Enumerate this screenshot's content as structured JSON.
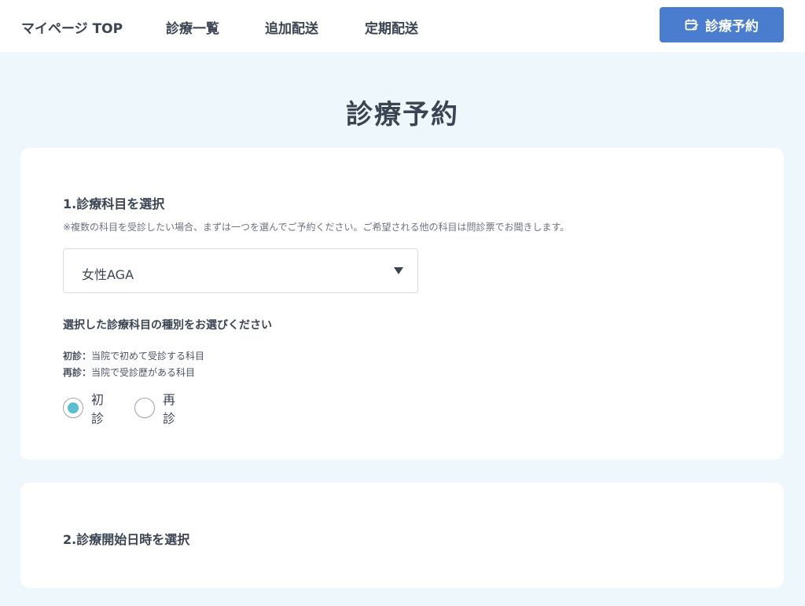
{
  "nav": {
    "items": [
      {
        "label": "マイページ TOP"
      },
      {
        "label": "診療一覧"
      },
      {
        "label": "追加配送"
      },
      {
        "label": "定期配送"
      }
    ],
    "reserve_button": {
      "label": "診療予約",
      "icon": "calendar-edit-icon"
    }
  },
  "page": {
    "title": "診療予約"
  },
  "section1": {
    "heading": "1.診療科目を選択",
    "note": "※複数の科目を受診したい場合、まずは一つを選んでご予約ください。ご希望される他の科目は問診票でお聞きします。",
    "select": {
      "value": "女性AGA"
    },
    "type_heading": "選択した診療科目の種別をお選びください",
    "definitions": [
      {
        "term": "初診：",
        "desc": "当院で初めて受診する科目"
      },
      {
        "term": "再診：",
        "desc": "当院で受診歴がある科目"
      }
    ],
    "radios": [
      {
        "label": "初診",
        "checked": true
      },
      {
        "label": "再診",
        "checked": false
      }
    ]
  },
  "section2": {
    "heading": "2.診療開始日時を選択"
  },
  "colors": {
    "background": "#eef8fc",
    "accent_button": "#4a7dce",
    "radio_checked": "#5bbfcf",
    "text": "#3b4452"
  }
}
